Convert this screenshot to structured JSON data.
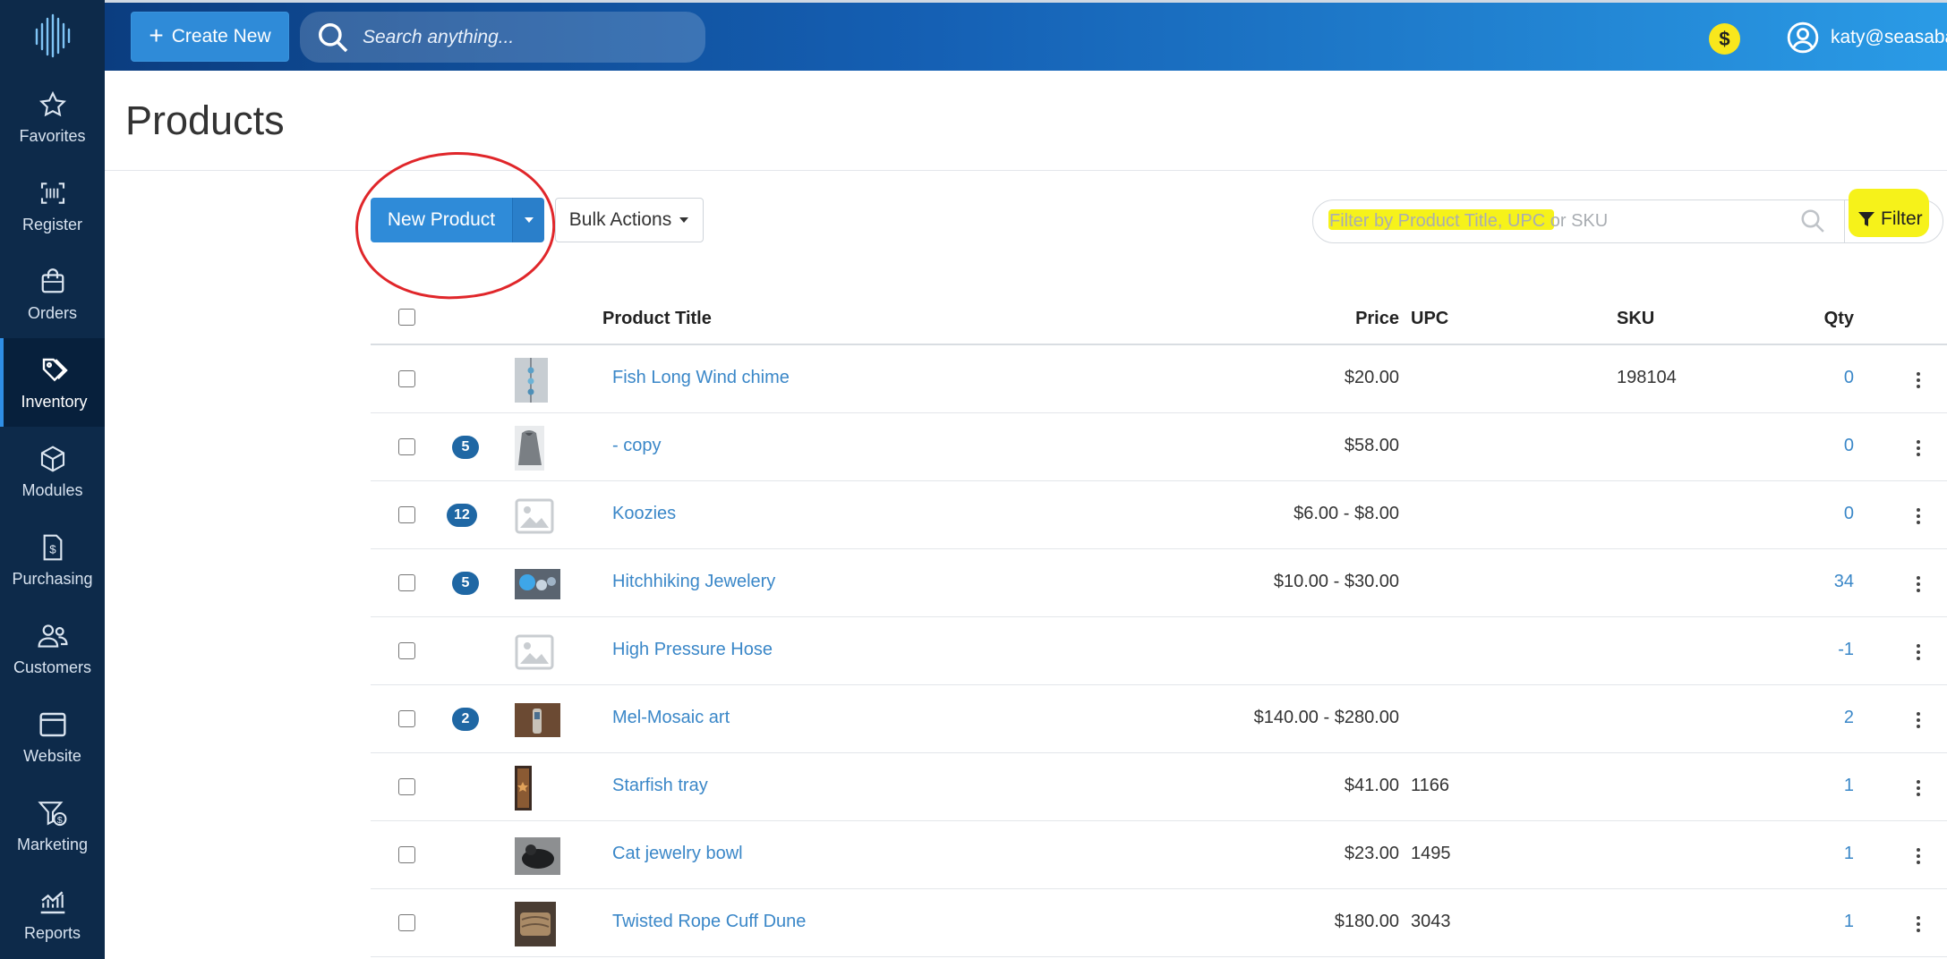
{
  "header": {
    "create_label": "Create New",
    "search_placeholder": "Search anything...",
    "coin_symbol": "$",
    "user_email": "katy@seasaba"
  },
  "sidebar": {
    "items": [
      {
        "label": "Favorites",
        "icon": "star-icon"
      },
      {
        "label": "Register",
        "icon": "barcode-scan-icon"
      },
      {
        "label": "Orders",
        "icon": "shopping-bag-icon"
      },
      {
        "label": "Inventory",
        "icon": "tags-icon",
        "active": true
      },
      {
        "label": "Modules",
        "icon": "box-icon"
      },
      {
        "label": "Purchasing",
        "icon": "invoice-icon"
      },
      {
        "label": "Customers",
        "icon": "users-icon"
      },
      {
        "label": "Website",
        "icon": "browser-window-icon"
      },
      {
        "label": "Marketing",
        "icon": "funnel-dollar-icon"
      },
      {
        "label": "Reports",
        "icon": "line-chart-icon"
      }
    ]
  },
  "page": {
    "title": "Products"
  },
  "toolbar": {
    "new_product_label": "New Product",
    "bulk_actions_label": "Bulk Actions",
    "filter_placeholder": "Filter by Product Title, UPC or SKU",
    "filter_label": "Filter"
  },
  "table": {
    "headers": {
      "title": "Product Title",
      "price": "Price",
      "upc": "UPC",
      "sku": "SKU",
      "qty": "Qty"
    },
    "rows": [
      {
        "badge": "",
        "title": "Fish Long Wind chime",
        "price": "$20.00",
        "upc": "",
        "sku": "198104",
        "qty": "0",
        "thumb": "windchime"
      },
      {
        "badge": "5",
        "title": "- copy",
        "price": "$58.00",
        "upc": "",
        "sku": "",
        "qty": "0",
        "thumb": "jacket"
      },
      {
        "badge": "12",
        "title": "Koozies",
        "price": "$6.00 - $8.00",
        "upc": "",
        "sku": "",
        "qty": "0",
        "thumb": "placeholder"
      },
      {
        "badge": "5",
        "title": "Hitchhiking Jewelery",
        "price": "$10.00 - $30.00",
        "upc": "",
        "sku": "",
        "qty": "34",
        "thumb": "jewelry"
      },
      {
        "badge": "",
        "title": "High Pressure Hose",
        "price": "",
        "upc": "",
        "sku": "",
        "qty": "-1",
        "thumb": "placeholder"
      },
      {
        "badge": "2",
        "title": "Mel-Mosaic art",
        "price": "$140.00 - $280.00",
        "upc": "",
        "sku": "",
        "qty": "2",
        "thumb": "mosaic"
      },
      {
        "badge": "",
        "title": "Starfish tray",
        "price": "$41.00",
        "upc": "1166",
        "sku": "",
        "qty": "1",
        "thumb": "tray"
      },
      {
        "badge": "",
        "title": "Cat jewelry bowl",
        "price": "$23.00",
        "upc": "1495",
        "sku": "",
        "qty": "1",
        "thumb": "bowl"
      },
      {
        "badge": "",
        "title": "Twisted Rope Cuff Dune",
        "price": "$180.00",
        "upc": "3043",
        "sku": "",
        "qty": "1",
        "thumb": "cuff"
      }
    ]
  },
  "colors": {
    "sidebar_bg": "#0d2a4a",
    "accent": "#2f8bd8",
    "link": "#3a87c8",
    "badge": "#1f67a4",
    "highlight": "#f6f21a",
    "annotation_circle": "#e0262a"
  }
}
